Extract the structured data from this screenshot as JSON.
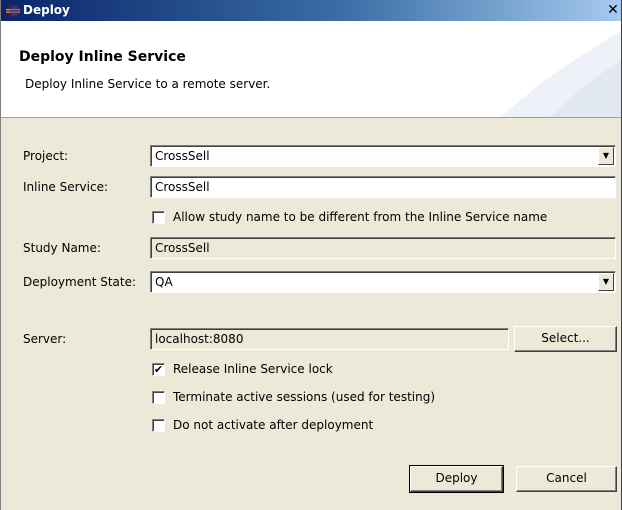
{
  "window": {
    "title": "Deploy",
    "icon": "eclipse-app-icon",
    "close_glyph": "✕"
  },
  "banner": {
    "heading": "Deploy Inline Service",
    "description": "Deploy Inline Service to a remote server."
  },
  "form": {
    "project_label": "Project:",
    "project_value": "CrossSell",
    "inline_service_label": "Inline Service:",
    "inline_service_value": "CrossSell",
    "allow_study_label": "Allow study name to be different from the Inline Service name",
    "allow_study_checked": false,
    "study_name_label": "Study Name:",
    "study_name_value": "CrossSell",
    "deployment_state_label": "Deployment State:",
    "deployment_state_value": "QA",
    "server_label": "Server:",
    "server_value": "localhost:8080",
    "select_button": "Select...",
    "release_lock_label": "Release Inline Service lock",
    "release_lock_checked": true,
    "terminate_label": "Terminate active sessions (used for testing)",
    "terminate_checked": false,
    "no_activate_label": "Do not activate after deployment",
    "no_activate_checked": false
  },
  "buttons": {
    "deploy": "Deploy",
    "cancel": "Cancel"
  },
  "colors": {
    "titlebar_start": "#0a246a",
    "titlebar_end": "#a6caf0",
    "dialog_bg": "#ece9d8"
  }
}
